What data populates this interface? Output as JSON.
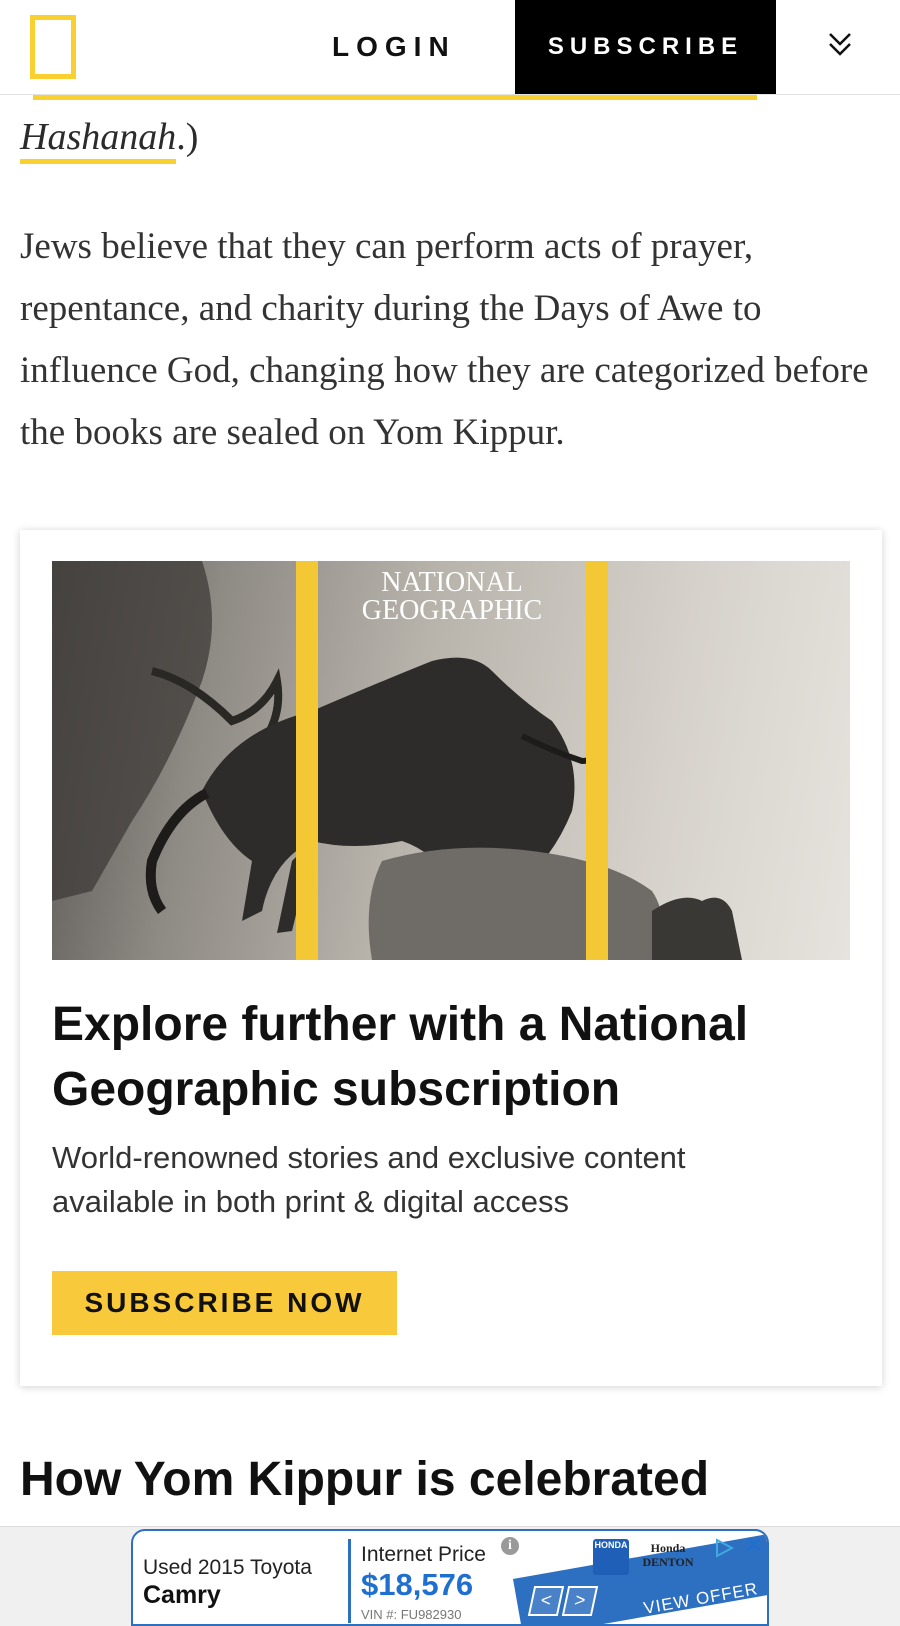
{
  "header": {
    "login_label": "LOGIN",
    "subscribe_label": "SUBSCRIBE"
  },
  "article": {
    "hashanah_link": "Hashanah",
    "hashanah_suffix": ".)",
    "paragraph": "Jews believe that they can perform acts of prayer, repentance, and charity during the Days of Awe to influence God, changing how they are categorized before the books are sealed on Yom Kippur."
  },
  "promo": {
    "magazine_brand": "NATIONAL GEOGRAPHIC",
    "title": "Explore further with a National Geographic subscription",
    "description": "World-renowned stories and exclusive content available in both print & digital access",
    "button_label": "SUBSCRIBE NOW"
  },
  "section_heading": "How Yom Kippur is celebrated",
  "ad": {
    "used_label": "Used 2015 Toyota",
    "model": "Camry",
    "price_label": "Internet Price",
    "price": "$18,576",
    "vin": "VIN #: FU982930",
    "brand_badge": "HONDA",
    "dealer": "Honda DENTON",
    "cta": "VIEW OFFER"
  },
  "colors": {
    "accent_yellow": "#f8d030",
    "header_black": "#000000",
    "ad_blue": "#2d6fc0"
  }
}
